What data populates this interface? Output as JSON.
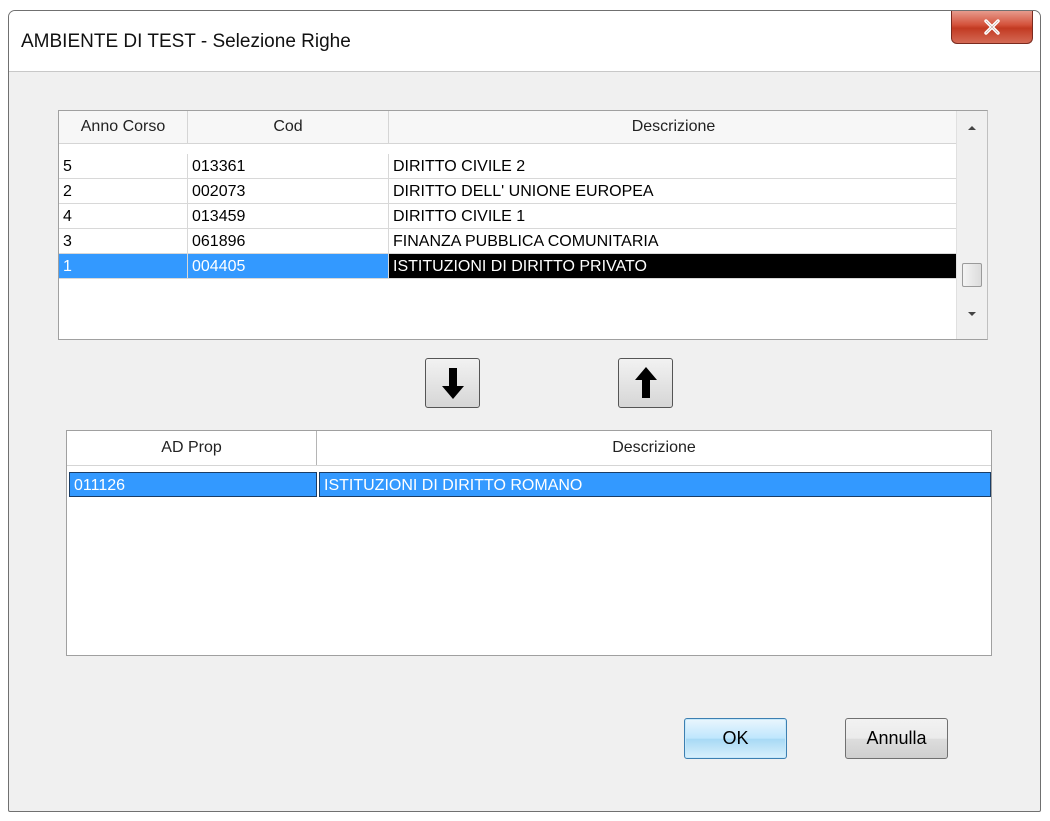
{
  "window": {
    "title": "AMBIENTE DI TEST - Selezione Righe",
    "close_label": "X"
  },
  "source_table": {
    "columns": [
      "Anno Corso",
      "Cod",
      "Descrizione"
    ],
    "rows": [
      {
        "anno": "5",
        "cod": "013361",
        "descr": "DIRITTO CIVILE 2"
      },
      {
        "anno": "2",
        "cod": "002073",
        "descr": "DIRITTO DELL' UNIONE EUROPEA"
      },
      {
        "anno": "4",
        "cod": "013459",
        "descr": "DIRITTO CIVILE 1"
      },
      {
        "anno": "3",
        "cod": "061896",
        "descr": "FINANZA PUBBLICA COMUNITARIA"
      },
      {
        "anno": "1",
        "cod": "004405",
        "descr": "ISTITUZIONI DI DIRITTO PRIVATO"
      }
    ],
    "selected_row_index": 4
  },
  "target_table": {
    "columns": [
      "AD Prop",
      "Descrizione"
    ],
    "rows": [
      {
        "ad_prop": "011126",
        "descr": "ISTITUZIONI DI DIRITTO ROMANO"
      }
    ],
    "selected_row_index": 0
  },
  "move_buttons": {
    "down_icon": "arrow-down-icon",
    "up_icon": "arrow-up-icon"
  },
  "buttons": {
    "ok": "OK",
    "cancel": "Annulla"
  },
  "colors": {
    "selection_blue": "#3399ff",
    "selection_black": "#000000",
    "close_red": "#c7402a"
  }
}
